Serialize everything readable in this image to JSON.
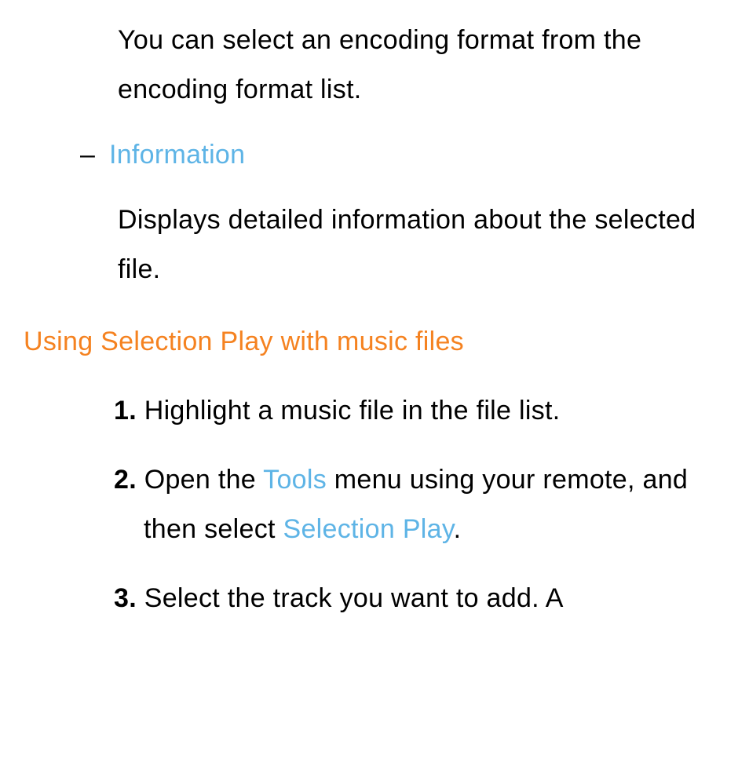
{
  "topParagraph": "You can select an encoding format from the encoding format list.",
  "dashMarker": "–",
  "informationLabel": "Information",
  "informationDesc": "Displays detailed information about the selected file.",
  "sectionTitle": "Using Selection Play with music files",
  "steps": {
    "1": {
      "num": "1.",
      "text": "Highlight a music file in the file list."
    },
    "2": {
      "num": "2.",
      "prefix": "Open the ",
      "tools": "Tools",
      "mid": " menu using your remote, and then select ",
      "selectionPlay": "Selection Play",
      "suffix": "."
    },
    "3": {
      "num": "3.",
      "text": "Select the track you want to add. A"
    }
  }
}
